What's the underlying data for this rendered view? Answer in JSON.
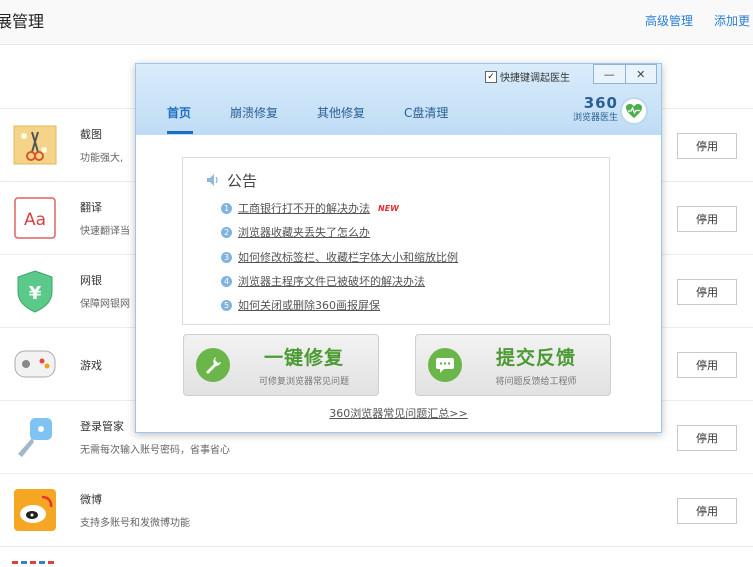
{
  "page": {
    "title": "展管理",
    "links": [
      "高级管理",
      "添加更"
    ]
  },
  "extensions": [
    {
      "name": "截图",
      "desc": "功能强大,",
      "icon": "screenshot-icon",
      "button": "停用"
    },
    {
      "name": "翻译",
      "desc": "快速翻译当",
      "icon": "translate-icon",
      "button": "停用"
    },
    {
      "name": "网银",
      "desc": "保障网银网",
      "icon": "bank-shield-icon",
      "button": "停用"
    },
    {
      "name": "游戏",
      "desc": "",
      "icon": "gamepad-icon",
      "button": "停用"
    },
    {
      "name": "登录管家",
      "desc": "无需每次输入账号密码，省事省心",
      "icon": "login-key-icon",
      "button": "停用"
    },
    {
      "name": "微博",
      "desc": "支持多账号和发微博功能",
      "icon": "weibo-icon",
      "button": "停用"
    }
  ],
  "dialog": {
    "checkbox_label": "快捷键调起医生",
    "checkbox_checked": true,
    "minimize": "—",
    "close": "✕",
    "tabs": [
      "首页",
      "崩溃修复",
      "其他修复",
      "C盘清理"
    ],
    "active_tab": "首页",
    "brand_number": "360",
    "brand_name": "浏览器医生",
    "notice_title": "公告",
    "notices": [
      {
        "num": "1",
        "text": "工商银行打不开的解决办法",
        "badge": "NEW"
      },
      {
        "num": "2",
        "text": "浏览器收藏夹丢失了怎么办",
        "badge": ""
      },
      {
        "num": "3",
        "text": "如何修改标签栏、收藏栏字体大小和缩放比例",
        "badge": ""
      },
      {
        "num": "4",
        "text": "浏览器主程序文件已被破坏的解决办法",
        "badge": ""
      },
      {
        "num": "5",
        "text": "如何关闭或删除360画报屏保",
        "badge": ""
      }
    ],
    "repair_button": {
      "title": "一键修复",
      "subtitle": "可修复浏览器常见问题"
    },
    "feedback_button": {
      "title": "提交反馈",
      "subtitle": "将问题反馈给工程师"
    },
    "faq_link": "360浏览器常见问题汇总>>"
  },
  "colors": {
    "accent": "#1e6dc2",
    "green": "#6ab64a",
    "header_bg": "#cde5f8"
  }
}
